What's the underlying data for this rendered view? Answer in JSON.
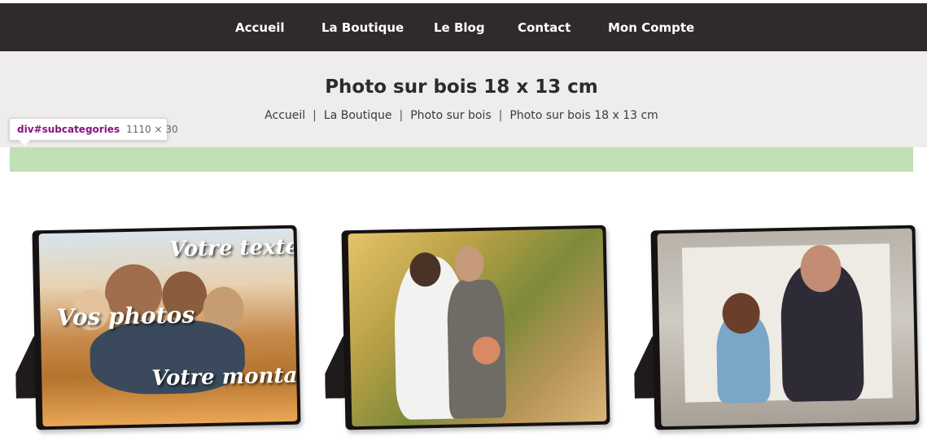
{
  "nav": {
    "items": [
      "Accueil",
      "La Boutique",
      "Le Blog",
      "Contact",
      "Mon Compte"
    ]
  },
  "header": {
    "title": "Photo sur bois 18 x 13 cm",
    "breadcrumb": [
      "Accueil",
      "La Boutique",
      "Photo sur bois",
      "Photo sur bois 18 x 13 cm"
    ],
    "separator": "|"
  },
  "devtools_tooltip": {
    "selector": "div#subcategories",
    "dimensions": "1110 × 30"
  },
  "products": [
    {
      "overlay_text": [
        "Votre texte",
        "Vos photos",
        "Votre montage"
      ]
    },
    {
      "overlay_text": []
    },
    {
      "overlay_text": []
    }
  ],
  "colors": {
    "nav_bg": "#2f2a2b",
    "header_bg": "#eeecec",
    "subcategories_bg": "#c2dfb5"
  }
}
